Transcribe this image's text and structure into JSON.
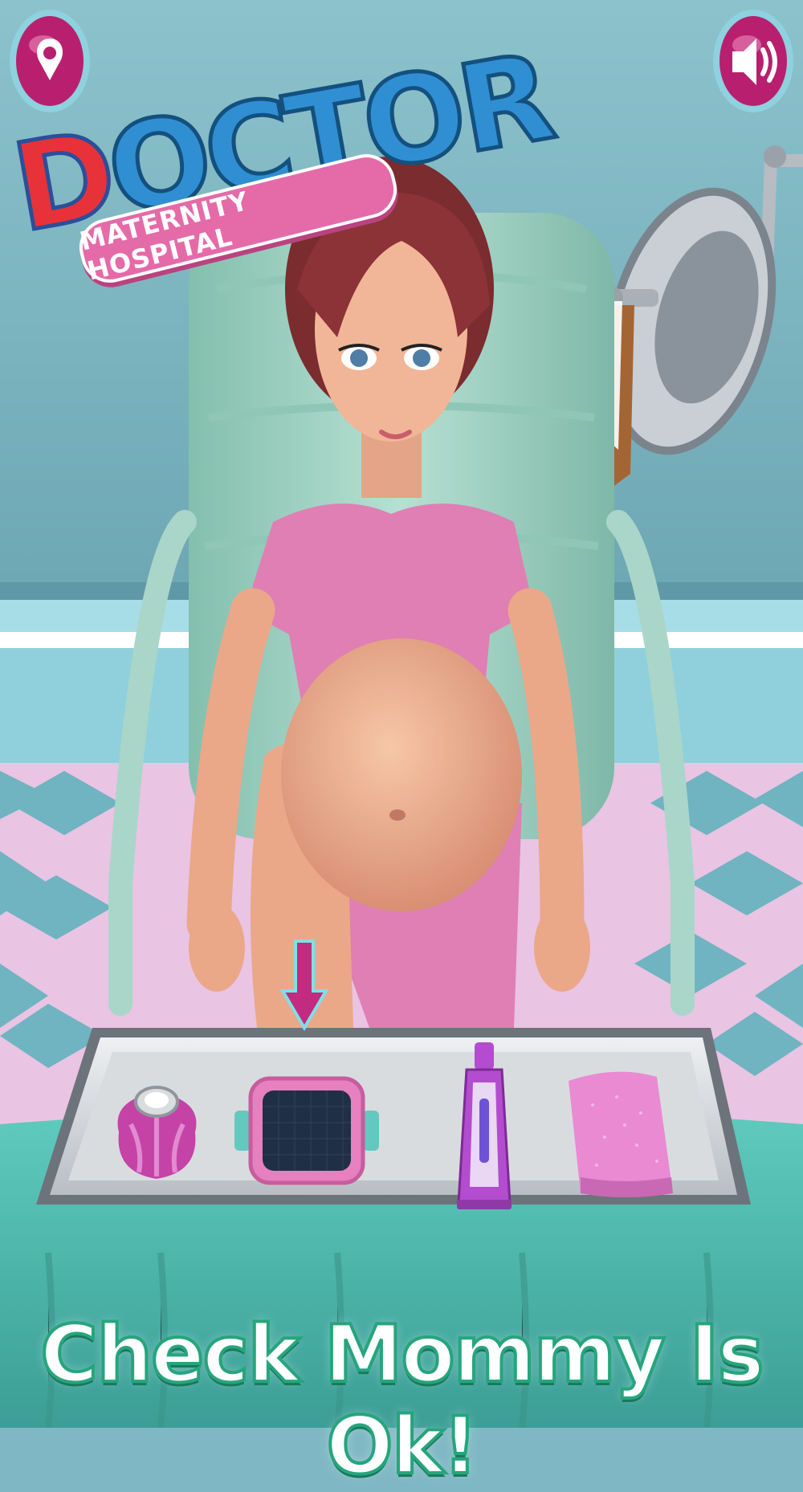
{
  "app": {
    "logo_main": "DOCTOR",
    "logo_initial": "D",
    "logo_rest": "OCTOR",
    "logo_subtitle": "MATERNITY HOSPITAL"
  },
  "hud": {
    "map_icon": "location-pin-icon",
    "sound_icon": "speaker-icon"
  },
  "tray": {
    "tools": [
      {
        "name": "ice-pack",
        "icon": "ice-pack-icon"
      },
      {
        "name": "ultrasound-monitor",
        "icon": "ultrasound-pad-icon",
        "highlighted": true
      },
      {
        "name": "gel-tube",
        "icon": "gel-tube-icon"
      },
      {
        "name": "pink-towel",
        "icon": "towel-icon"
      }
    ],
    "pointer": "down-arrow-icon"
  },
  "instruction": "Check Mommy Is Ok!",
  "colors": {
    "wall": "#7fb8c4",
    "chair": "#9fd0c1",
    "shirt": "#e07fb3",
    "accent_pink": "#c22b7f",
    "instruction_outline": "#26a57c"
  }
}
